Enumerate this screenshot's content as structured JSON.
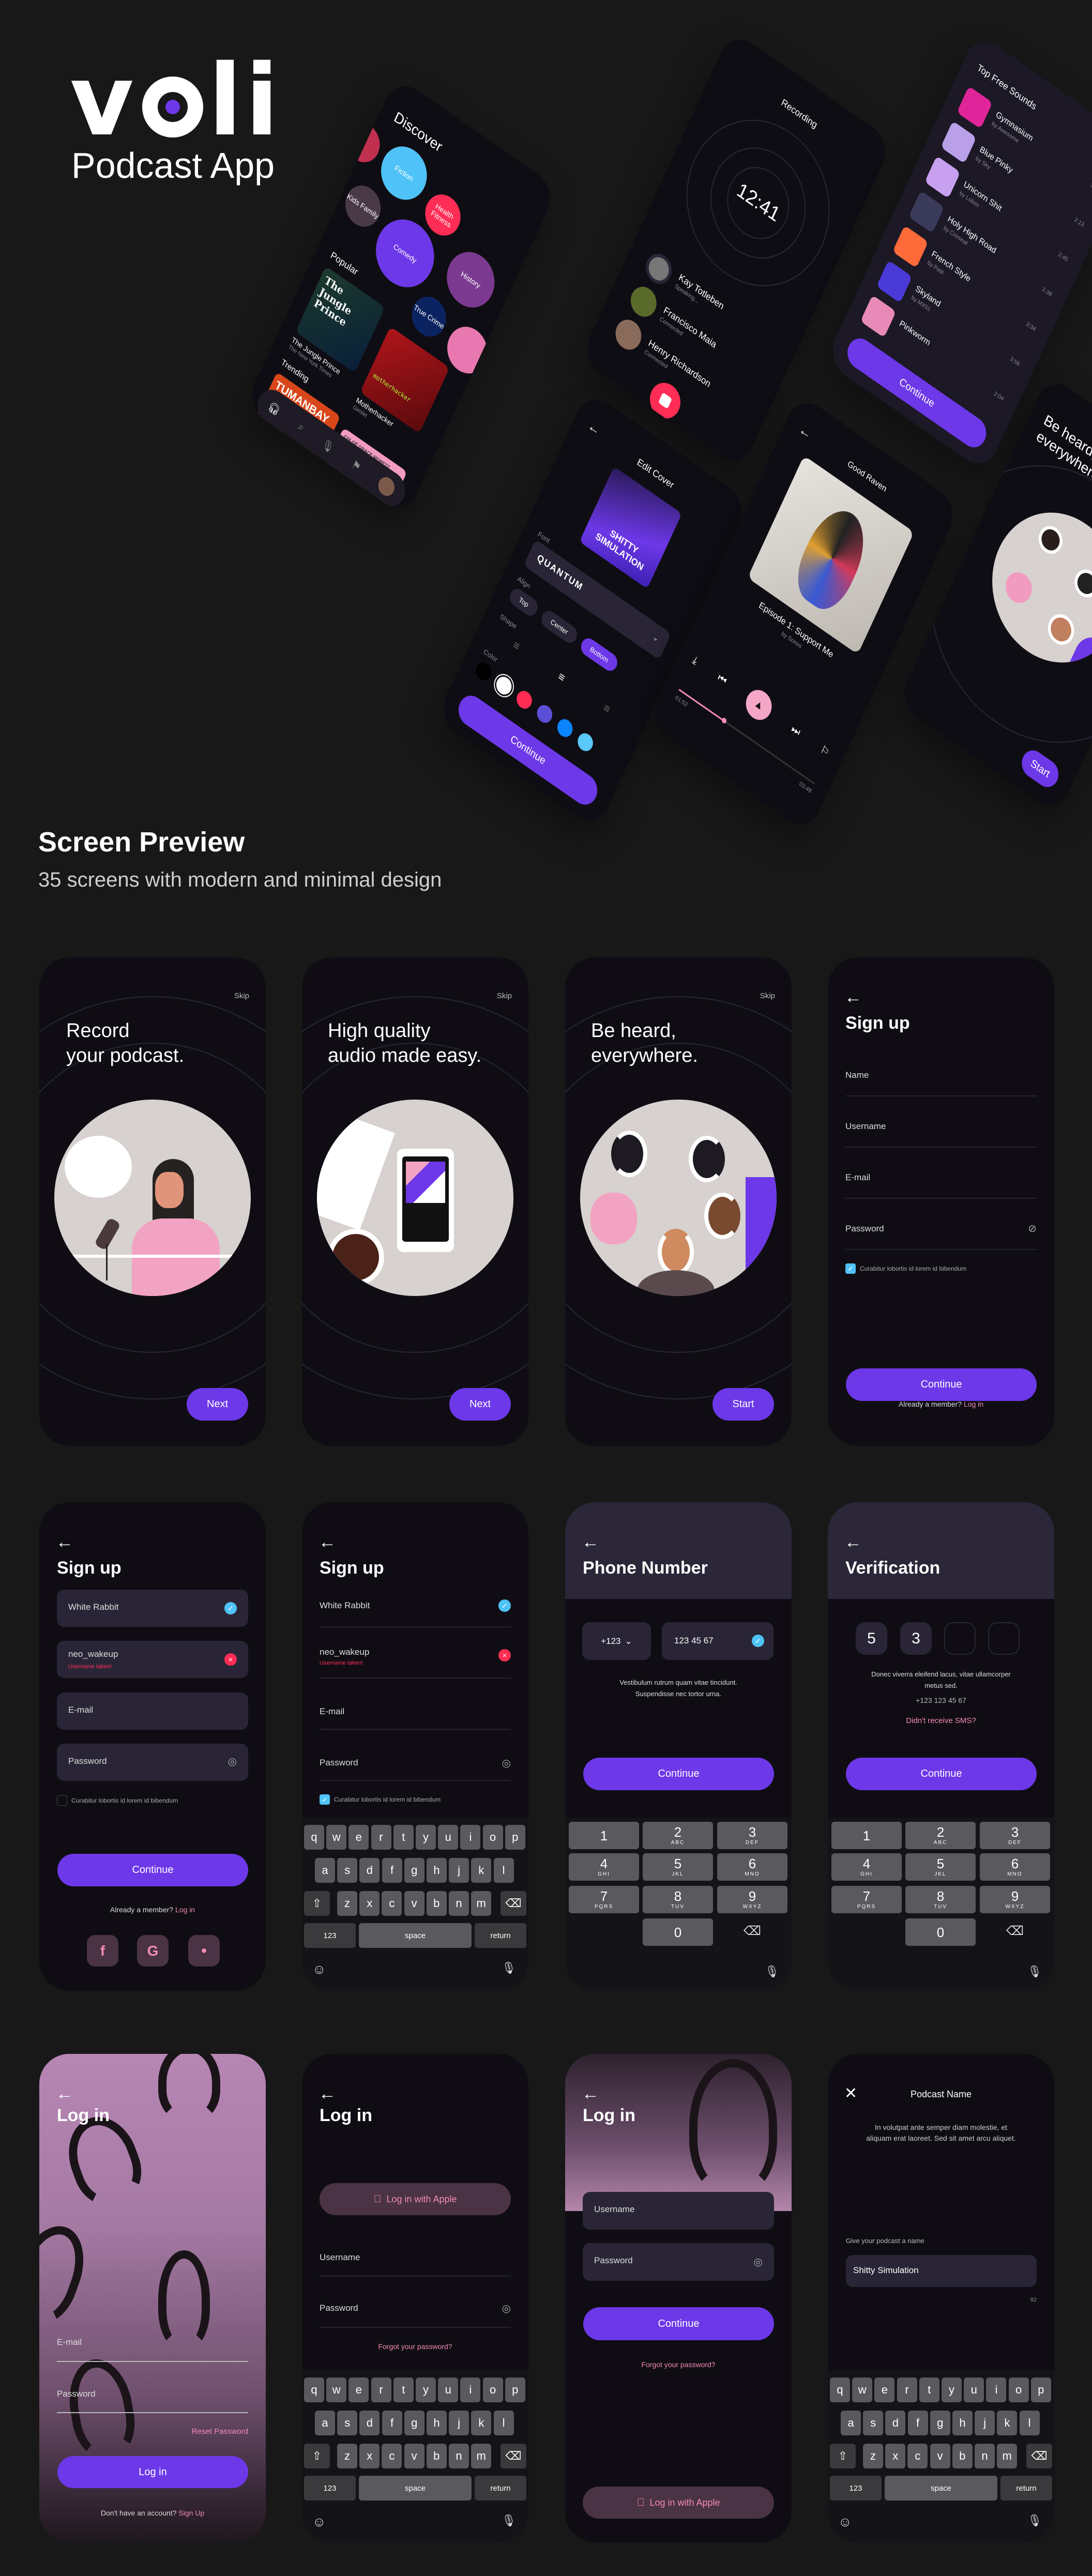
{
  "brand": {
    "logo_letters": [
      "v",
      "o",
      "l",
      "i"
    ],
    "subtitle": "Podcast App",
    "accent": "#6d38e8",
    "link_color": "#f38bb6"
  },
  "hero": {
    "discover": {
      "title": "Discover",
      "categories": [
        {
          "label": "Fiction",
          "color": "#4fc3f7"
        },
        {
          "label": "Health Fitness",
          "color": "#ff2d55"
        },
        {
          "label": "Kids Family",
          "color": "#4a3a48"
        },
        {
          "label": "Comedy",
          "color": "#6d38e8"
        },
        {
          "label": "History",
          "color": "#7b3a8f"
        },
        {
          "label": "True Crime",
          "color": "#0b2360"
        }
      ],
      "popular_label": "Popular",
      "popular": [
        {
          "title": "The Jungle Prince",
          "author": "The New York Times",
          "cover_text": "The Jungle Prince"
        },
        {
          "title": "Motherhacker",
          "author": "Gimlet",
          "cover_text": "motherhacker"
        }
      ],
      "trending_label": "Trending",
      "trending": [
        {
          "cover_text": "TUMANBAY"
        },
        {
          "cover_text": "GASLIGHT",
          "cover_subtext": "CHLOË GRACE MORETZ"
        }
      ],
      "nav_icons": [
        "headphones-icon",
        "search-icon",
        "mic-icon",
        "bookmark-icon",
        "avatar"
      ]
    },
    "recording": {
      "title": "Recording",
      "time": "12:41",
      "participants": [
        {
          "name": "Kay Totleben",
          "status": "Speaking..."
        },
        {
          "name": "Francisco Maia",
          "status": "Connected"
        },
        {
          "name": "Henry Richardson",
          "status": "Connected"
        }
      ]
    },
    "edit_cover": {
      "title": "Edit Cover",
      "cover_text": "SHITTY SIMULATION",
      "font_label": "Font",
      "font_value": "QUANTUM",
      "align_label": "Align",
      "align_options": [
        "Top",
        "Center",
        "Bottom"
      ],
      "align_selected": "Bottom",
      "shape_label": "Shape",
      "color_label": "Color",
      "colors": [
        "#000000",
        "#ffffff",
        "#ff2d55",
        "#5b4fd8",
        "#0a84ff",
        "#5ac8fa"
      ],
      "continue": "Continue"
    },
    "sounds": {
      "title": "Top Free Sounds",
      "tracks": [
        {
          "title": "Gymnasium",
          "artist": "by Awesome",
          "duration": "3:28"
        },
        {
          "title": "Blue Pinky",
          "artist": "by Sky",
          "duration": "2:13"
        },
        {
          "title": "Unicorn Shit",
          "artist": "by Lobox",
          "duration": "2:45"
        },
        {
          "title": "Holy High Road",
          "artist": "by Criminal",
          "duration": "1:38"
        },
        {
          "title": "French Style",
          "artist": "by Petit",
          "duration": "3:34"
        },
        {
          "title": "Skyland",
          "artist": "by MX51",
          "duration": "3:56"
        },
        {
          "title": "Pinkworm",
          "artist": "",
          "duration": "2:04"
        }
      ],
      "continue": "Continue"
    },
    "player": {
      "title": "Good Raven",
      "episode": "Episode 1: Support Me",
      "author": "by Sonos",
      "elapsed": "01:52",
      "total": "03:48",
      "progress": 0.33
    },
    "onboard": {
      "title": "Be heard, everywhere.",
      "start": "Start"
    }
  },
  "preview": {
    "title": "Screen Preview",
    "subtitle": "35 screens with modern and minimal design"
  },
  "screens": {
    "onboarding": [
      {
        "skip": "Skip",
        "line1": "Record",
        "line2": "your podcast.",
        "button": "Next"
      },
      {
        "skip": "Skip",
        "line1": "High quality",
        "line2": "audio made easy.",
        "button": "Next"
      },
      {
        "skip": "Skip",
        "line1": "Be heard,",
        "line2": "everywhere.",
        "button": "Start"
      }
    ],
    "signup_empty": {
      "title": "Sign up",
      "fields": [
        "Name",
        "Username",
        "E-mail",
        "Password"
      ],
      "terms": "Curabitur lobortis id lorem id bibendum",
      "terms_checked": true,
      "continue": "Continue",
      "member_prompt": "Already a member?",
      "login_link": "Log in"
    },
    "signup_filled": {
      "title": "Sign up",
      "name": "White Rabbit",
      "username": "neo_wakeup",
      "username_error": "Username taken!",
      "email": "E-mail",
      "password": "Password",
      "terms": "Curabitur lobortis id lorem id bibendum",
      "terms_checked": false,
      "continue": "Continue",
      "member_prompt": "Already a member?",
      "login_link": "Log in",
      "social": [
        "f",
        "G",
        ""
      ]
    },
    "signup_keyboard": {
      "title": "Sign up",
      "name": "White Rabbit",
      "username": "neo_wakeup",
      "username_error": "Username taken!",
      "email": "E-mail",
      "password": "Password",
      "terms": "Curabitur lobortis id lorem id bibendum",
      "terms_checked": true
    },
    "phone": {
      "title": "Phone Number",
      "country_code": "+123",
      "number": "123 45 67",
      "info": "Vestibulum rutrum quam vitae tincidunt. Suspendisse nec tortor urna.",
      "continue": "Continue"
    },
    "verification": {
      "title": "Verification",
      "digits": [
        "5",
        "3",
        "",
        ""
      ],
      "info": "Donec viverra eleifend lacus, vitae ullamcorper metus sed.",
      "phone": "+123 123 45 67",
      "resend": "Didn't receive SMS?",
      "continue": "Continue"
    },
    "login_photo": {
      "title": "Log in",
      "email": "E-mail",
      "password": "Password",
      "reset": "Reset Password",
      "button": "Log in",
      "prompt": "Don't have an account?",
      "signup_link": "Sign Up"
    },
    "login_keyboard": {
      "title": "Log in",
      "apple": "Log in with Apple",
      "username": "Username",
      "password": "Password",
      "forgot": "Forgot your password?"
    },
    "login_header": {
      "title": "Log in",
      "username": "Username",
      "password": "Password",
      "continue": "Continue",
      "forgot": "Forgot your password?",
      "apple": "Log in with Apple"
    },
    "podcast_name": {
      "title": "Podcast Name",
      "description": "In volutpat ante semper diam molestie, et aliquam erat laoreet. Sed sit amet arcu aliquet.",
      "label": "Give your podcast a name",
      "value": "Shitty Simulation",
      "counter": "82"
    }
  },
  "keyboard": {
    "rows": [
      [
        "q",
        "w",
        "e",
        "r",
        "t",
        "y",
        "u",
        "i",
        "o",
        "p"
      ],
      [
        "a",
        "s",
        "d",
        "f",
        "g",
        "h",
        "j",
        "k",
        "l"
      ],
      [
        "z",
        "x",
        "c",
        "v",
        "b",
        "n",
        "m"
      ]
    ],
    "shift": "⇧",
    "delete": "⌫",
    "numbers": "123",
    "space": "space",
    "return": "return",
    "emoji": "☺",
    "mic": "🎙"
  },
  "numpad": {
    "keys": [
      {
        "d": "1",
        "l": ""
      },
      {
        "d": "2",
        "l": "ABC"
      },
      {
        "d": "3",
        "l": "DEF"
      },
      {
        "d": "4",
        "l": "GHI"
      },
      {
        "d": "5",
        "l": "JKL"
      },
      {
        "d": "6",
        "l": "MNO"
      },
      {
        "d": "7",
        "l": "PQRS"
      },
      {
        "d": "8",
        "l": "TUV"
      },
      {
        "d": "9",
        "l": "WXYZ"
      },
      {
        "d": "0",
        "l": ""
      }
    ],
    "delete": "⌫",
    "mic": "🎙"
  }
}
